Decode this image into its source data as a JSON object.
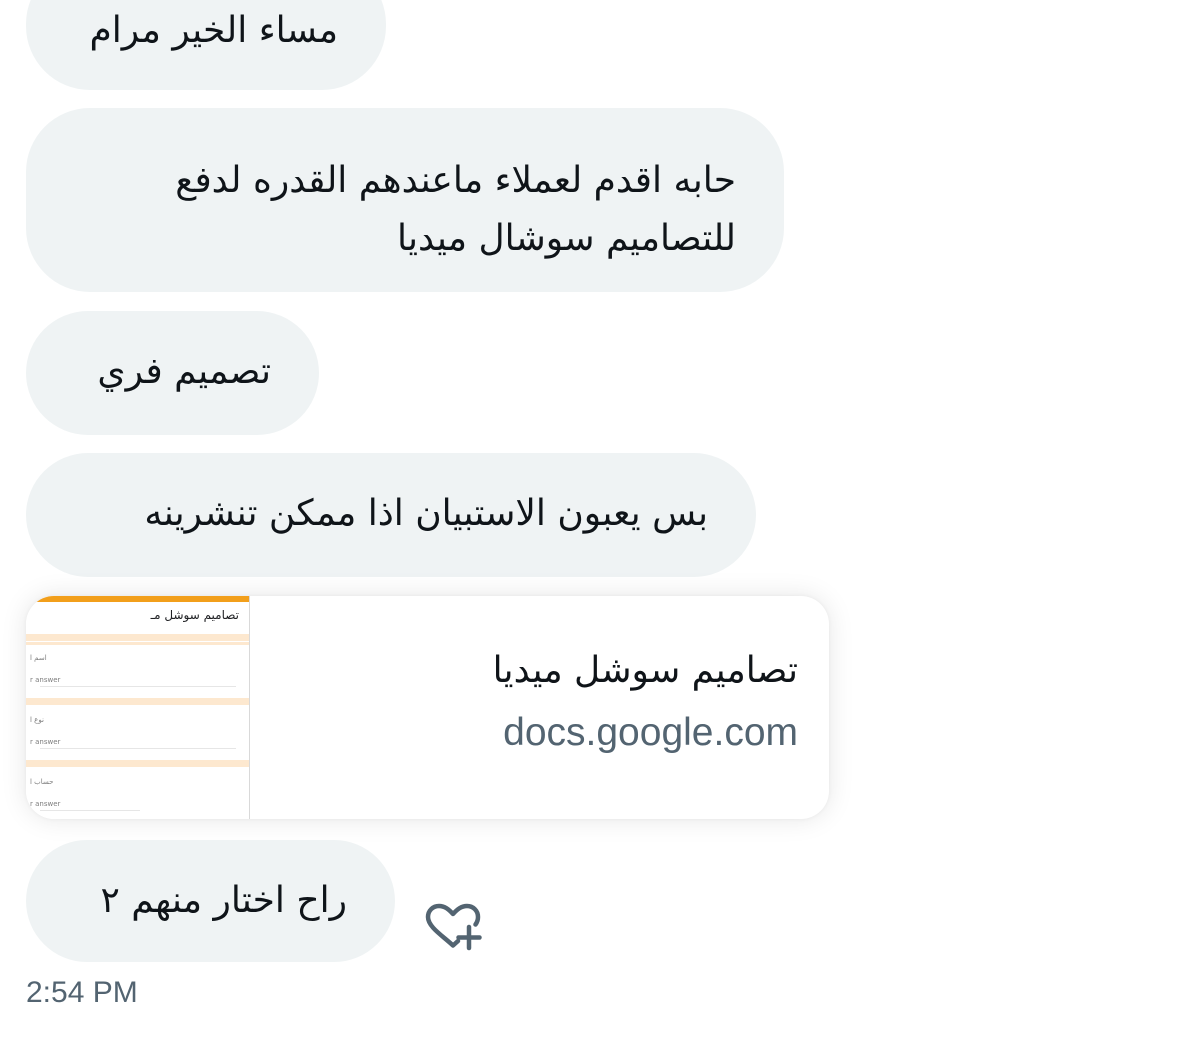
{
  "messages": [
    {
      "text": "مساء الخير مرام"
    },
    {
      "line1": "حابه اقدم لعملاء ماعندهم القدره لدفع",
      "line2": "للتصاميم سوشال ميديا"
    },
    {
      "text": "تصميم فري"
    },
    {
      "text": "بس يعبون الاستبيان اذا ممكن تنشرينه"
    },
    {
      "text": "راح اختار منهم ٢"
    }
  ],
  "link_card": {
    "title": "تصاميم سوشل ميديا",
    "domain": "docs.google.com",
    "thumbnail": {
      "form_title": "تصاميم سوشل مـ",
      "field1_label": "اسم ا",
      "field2_label": "نوع ا",
      "field3_label": "حساب ا",
      "answer_placeholder": "r answer",
      "accent_color": "#f29f1b"
    }
  },
  "reaction": {
    "icon": "heart-plus-icon"
  },
  "timestamp": "2:54 PM"
}
